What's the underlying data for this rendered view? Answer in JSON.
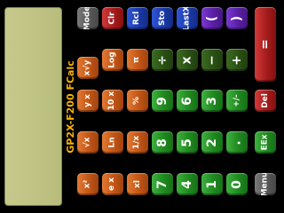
{
  "app": {
    "title": "GP2X-F200 FCalc"
  },
  "display": {
    "value": ""
  },
  "keys": {
    "mode": "Mode",
    "sqrt": "√x",
    "xsq": "x²",
    "clr": "Clr",
    "log": "Log",
    "ln": "Ln",
    "exp": "e x",
    "rcl": "Rcl",
    "pi": "π",
    "tenx": "10 x",
    "ypow": "y x",
    "yroot": "x√y",
    "sto": "Sto",
    "pct": "%",
    "inv": "1/x",
    "xl": "xl",
    "lastx": "LastX",
    "div": "÷",
    "mul": "x",
    "minus": "−",
    "plus": "+",
    "lparen": "(",
    "rparen": ")",
    "equals": "=",
    "n0": "0",
    "n1": "1",
    "n2": "2",
    "n3": "3",
    "n4": "4",
    "n5": "5",
    "n6": "6",
    "n7": "7",
    "n8": "8",
    "n9": "9",
    "dot": ".",
    "plusminus": "+/-",
    "eex": "EEx",
    "del": "Del",
    "menu": "Menu"
  }
}
